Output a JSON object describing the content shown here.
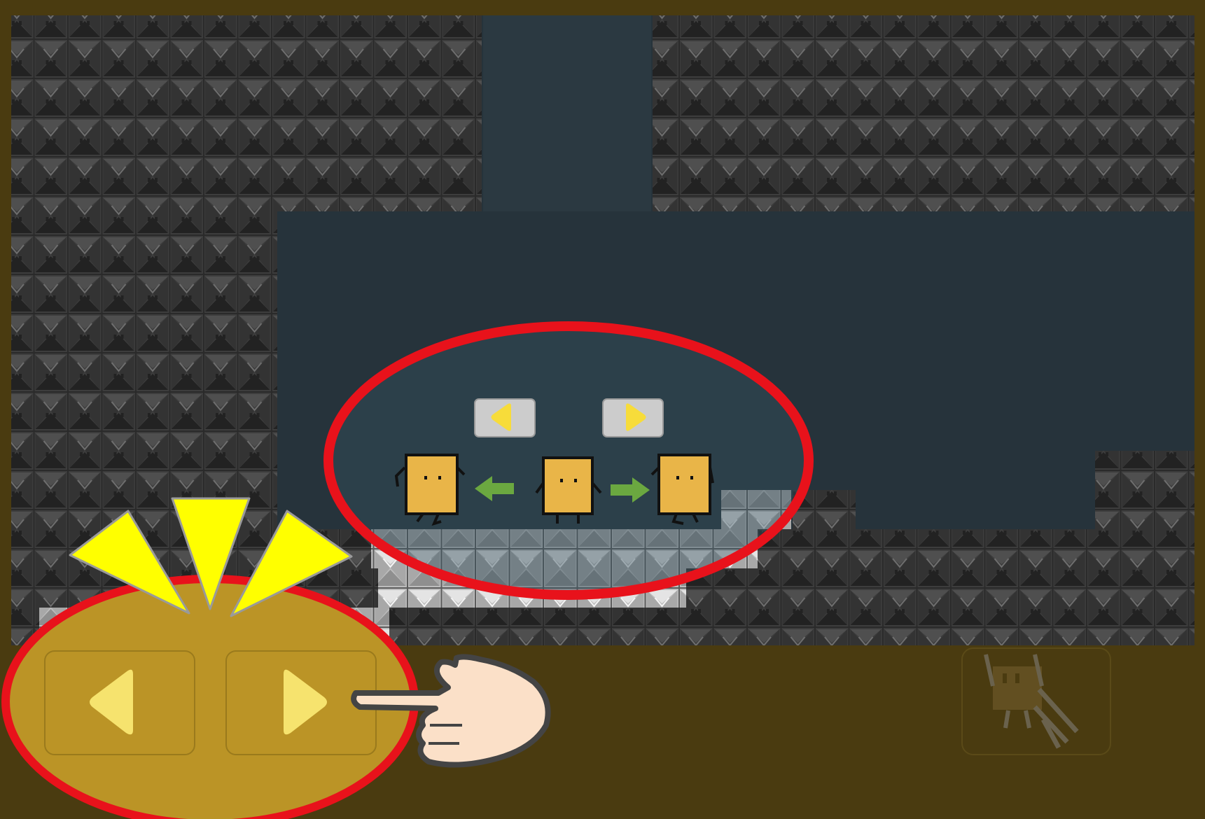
{
  "game": {
    "screen": "movement-tutorial",
    "controls": {
      "left_button": {
        "icon": "left-triangle-icon"
      },
      "right_button": {
        "icon": "right-triangle-icon"
      },
      "dash_button": {
        "icon": "dash-character-icon",
        "enabled": false
      }
    },
    "tutorial": {
      "mini_left_button": {
        "icon": "left-triangle-icon"
      },
      "mini_right_button": {
        "icon": "right-triangle-icon"
      },
      "move_arrows": [
        "arrow-left-icon",
        "arrow-right-icon"
      ],
      "pointer": "hand-pointer-icon",
      "highlight": "yellow-burst-icon"
    },
    "colors": {
      "frame": "#4a3b10",
      "sky": "#26333b",
      "block_dark": "#3b3b3b",
      "block_light": "#b5b5b5",
      "highlight_ring": "#e8121b",
      "button_panel": "#bb9426",
      "button_glyph": "#f6e36e",
      "character": "#e9b548",
      "arrow_green": "#6ba840",
      "burst_yellow": "#ffff00"
    }
  }
}
